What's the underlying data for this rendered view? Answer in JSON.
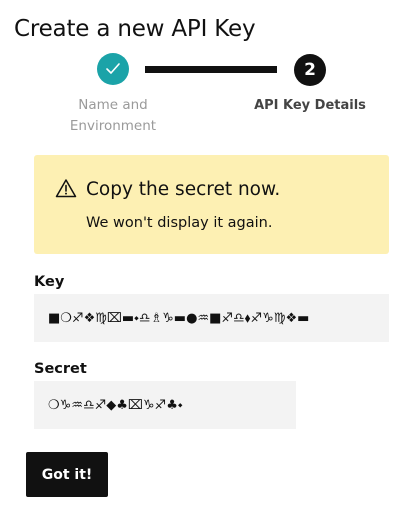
{
  "page_title": "Create a new API Key",
  "stepper": {
    "step1": {
      "label": "Name and Environment",
      "state": "completed",
      "icon": "check-icon",
      "color": "#1ba3a8"
    },
    "step2": {
      "number": "2",
      "label": "API Key Details",
      "state": "active",
      "color": "#111111"
    }
  },
  "alert": {
    "icon": "warning-icon",
    "title": "Copy the secret now.",
    "body": "We won't display it again.",
    "background": "#fdf0b3"
  },
  "key_field": {
    "label": "Key",
    "value": "■❍♐❖♍⌧▬⬩♎♗♑▬●♒■♐♎⬧♐♑♍❖▬"
  },
  "secret_field": {
    "label": "Secret",
    "value": "❍♑♒♎♐◆♣⌧♑♐♣⬩"
  },
  "confirm_button": {
    "label": "Got it!"
  }
}
